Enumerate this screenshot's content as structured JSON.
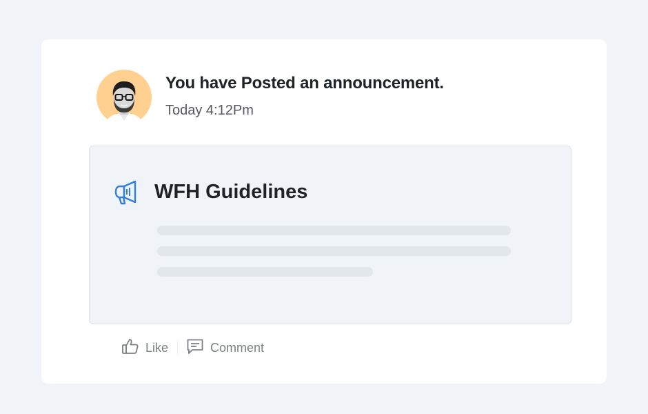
{
  "post": {
    "headline": "You have Posted an announcement.",
    "timestamp": "Today 4:12Pm",
    "avatar_bg": "#ffd08f"
  },
  "announcement": {
    "title": "WFH Guidelines",
    "icon": "megaphone-icon",
    "accent": "#2f7ee0"
  },
  "actions": {
    "like_label": "Like",
    "comment_label": "Comment",
    "like_icon": "thumbs-up-icon",
    "comment_icon": "comment-icon"
  }
}
